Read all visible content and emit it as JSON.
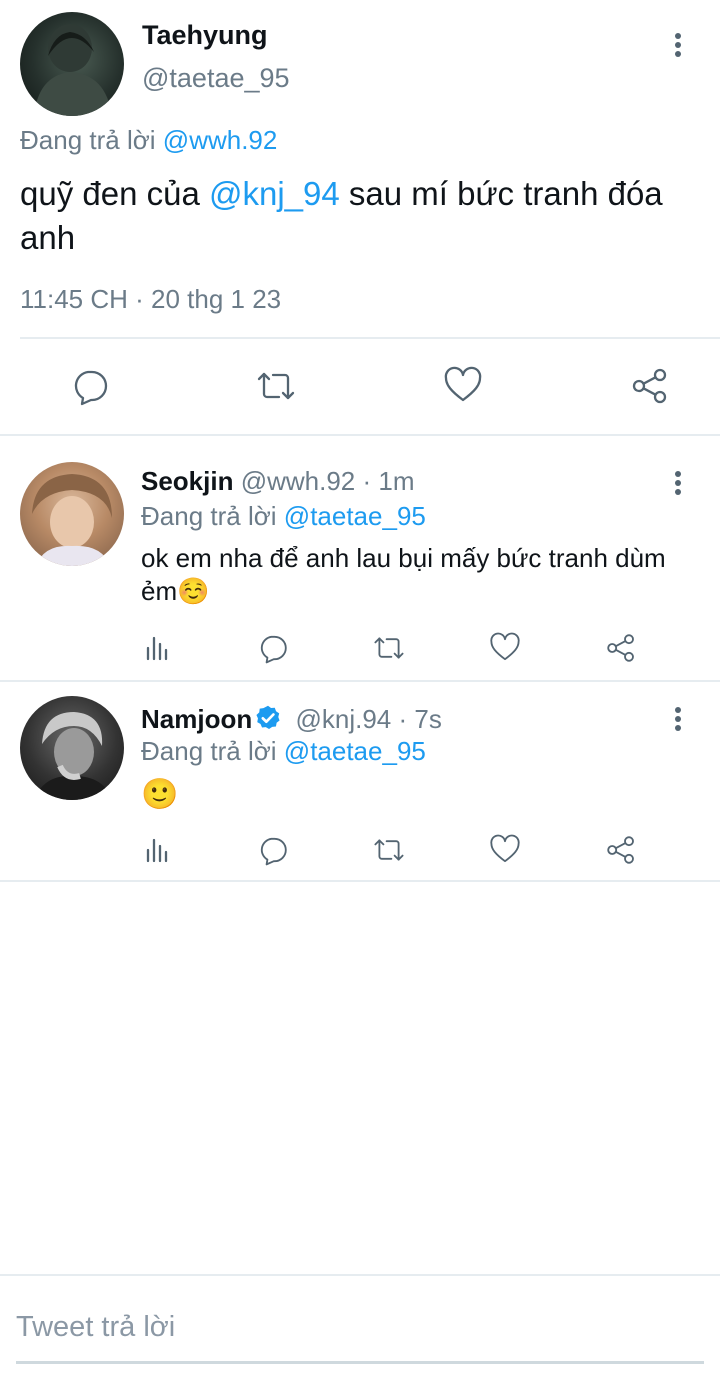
{
  "main_tweet": {
    "author_name": "Taehyung",
    "handle": "@taetae_95",
    "replying_label": "Đang trả lời",
    "replying_to": "@wwh.92",
    "text_before": "quỹ đen của ",
    "mention": "@knj_94",
    "text_after": " sau mí bức tranh đóa anh",
    "timestamp": "11:45 CH · 20 thg 1 23"
  },
  "replies": [
    {
      "author_name": "Seokjin",
      "handle": "@wwh.92",
      "time": "· 1m",
      "replying_label": "Đang trả lời",
      "replying_to": "@taetae_95",
      "text": "ok em nha để anh lau bụi mấy bức tranh dùm ẻm☺️"
    },
    {
      "author_name": "Namjoon",
      "verified": true,
      "handle": "@knj.94",
      "time": "· 7s",
      "replying_label": "Đang trả lời",
      "replying_to": "@taetae_95",
      "text": "🙂"
    }
  ],
  "composer": {
    "placeholder": "Tweet trả lời"
  },
  "icons": {
    "reply": "comment-icon",
    "retweet": "retweet-icon",
    "like": "heart-icon",
    "share": "share-icon",
    "analytics": "analytics-icon",
    "more": "more-vertical-icon",
    "verified": "verified-badge-icon"
  },
  "colors": {
    "accent": "#1d9bf0",
    "muted_text": "#6b7b88",
    "divider": "#e6ecf0"
  }
}
